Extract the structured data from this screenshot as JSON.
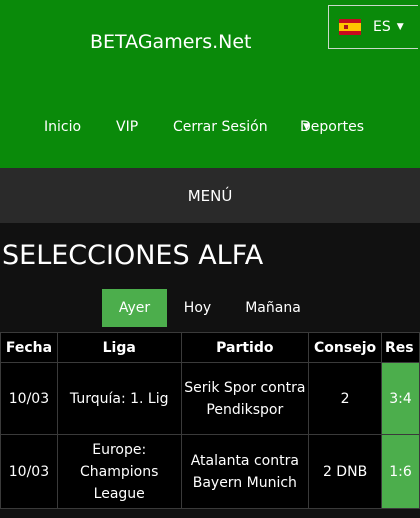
{
  "header": {
    "brand": "BETAGamers.Net",
    "language": {
      "label": "ES",
      "flag": "spain-flag-icon"
    },
    "nav": [
      {
        "label": "Inicio"
      },
      {
        "label": "VIP"
      },
      {
        "label": "Cerrar Sesión"
      },
      {
        "label": "Deportes"
      }
    ]
  },
  "menu": {
    "label": "MENÚ"
  },
  "page_title": "SELECCIONES ALFA",
  "day_tabs": [
    {
      "label": "Ayer",
      "active": true
    },
    {
      "label": "Hoy",
      "active": false
    },
    {
      "label": "Mañana",
      "active": false
    }
  ],
  "table": {
    "headers": [
      "Fecha",
      "Liga",
      "Partido",
      "Consejo",
      "Res"
    ],
    "rows": [
      {
        "fecha": "10/03",
        "liga": "Turquía: 1. Lig",
        "partido": "Serik Spor contra Pendikspor",
        "consejo": "2",
        "res": "3:4"
      },
      {
        "fecha": "10/03",
        "liga": "Europe: Champions League",
        "partido": "Atalanta contra Bayern Munich",
        "consejo": "2 DNB",
        "res": "1:6"
      }
    ]
  },
  "colors": {
    "header_green": "#0a8a0a",
    "result_green": "#4cae4c",
    "menu_bar": "#2a2a2a",
    "page_bg": "#111111"
  }
}
